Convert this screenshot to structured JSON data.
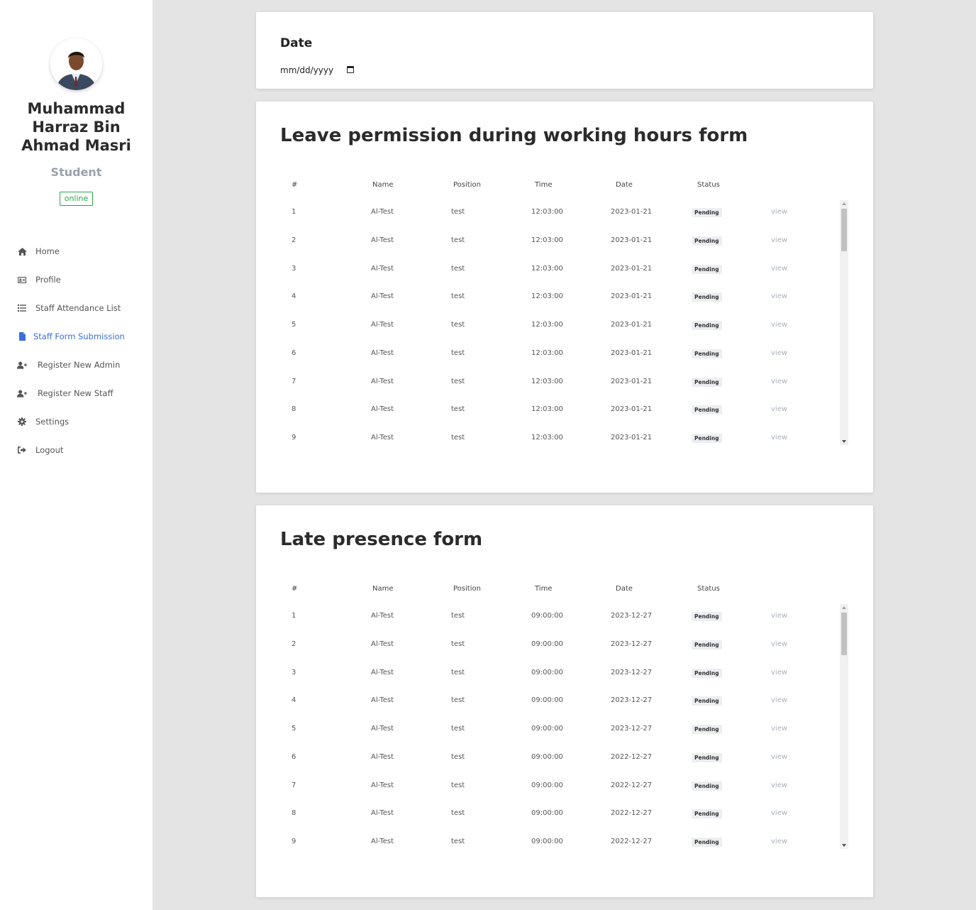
{
  "sidebar": {
    "user_name": "Muhammad Harraz Bin Ahmad Masri",
    "role": "Student",
    "status": "online",
    "nav": [
      {
        "label": "Home",
        "icon": "home-icon"
      },
      {
        "label": "Profile",
        "icon": "id-card-icon"
      },
      {
        "label": "Staff Attendance List",
        "icon": "list-icon"
      },
      {
        "label": "Staff Form Submission",
        "icon": "file-icon",
        "active": true
      },
      {
        "label": "Register New Admin",
        "icon": "user-plus-icon"
      },
      {
        "label": "Register New Staff",
        "icon": "user-plus-icon"
      },
      {
        "label": "Settings",
        "icon": "gear-icon"
      },
      {
        "label": "Logout",
        "icon": "sign-out-icon"
      }
    ]
  },
  "date_filter": {
    "label": "Date",
    "placeholder": "mm/dd/yyyy"
  },
  "columns": [
    "#",
    "Name",
    "Position",
    "Time",
    "Date",
    "Status"
  ],
  "leave_form": {
    "title": "Leave permission during working hours form",
    "rows": [
      {
        "num": "1",
        "name": "Al-Test",
        "position": "test",
        "time": "12:03:00",
        "date": "2023-01-21",
        "status": "Pending",
        "action": "view"
      },
      {
        "num": "2",
        "name": "Al-Test",
        "position": "test",
        "time": "12:03:00",
        "date": "2023-01-21",
        "status": "Pending",
        "action": "view"
      },
      {
        "num": "3",
        "name": "Al-Test",
        "position": "test",
        "time": "12:03:00",
        "date": "2023-01-21",
        "status": "Pending",
        "action": "view"
      },
      {
        "num": "4",
        "name": "Al-Test",
        "position": "test",
        "time": "12:03:00",
        "date": "2023-01-21",
        "status": "Pending",
        "action": "view"
      },
      {
        "num": "5",
        "name": "Al-Test",
        "position": "test",
        "time": "12:03:00",
        "date": "2023-01-21",
        "status": "Pending",
        "action": "view"
      },
      {
        "num": "6",
        "name": "Al-Test",
        "position": "test",
        "time": "12:03:00",
        "date": "2023-01-21",
        "status": "Pending",
        "action": "view"
      },
      {
        "num": "7",
        "name": "Al-Test",
        "position": "test",
        "time": "12:03:00",
        "date": "2023-01-21",
        "status": "Pending",
        "action": "view"
      },
      {
        "num": "8",
        "name": "Al-Test",
        "position": "test",
        "time": "12:03:00",
        "date": "2023-01-21",
        "status": "Pending",
        "action": "view"
      },
      {
        "num": "9",
        "name": "Al-Test",
        "position": "test",
        "time": "12:03:00",
        "date": "2023-01-21",
        "status": "Pending",
        "action": "view"
      }
    ]
  },
  "late_form": {
    "title": "Late presence form",
    "rows": [
      {
        "num": "1",
        "name": "Al-Test",
        "position": "test",
        "time": "09:00:00",
        "date": "2023-12-27",
        "status": "Pending",
        "action": "view"
      },
      {
        "num": "2",
        "name": "Al-Test",
        "position": "test",
        "time": "09:00:00",
        "date": "2023-12-27",
        "status": "Pending",
        "action": "view"
      },
      {
        "num": "3",
        "name": "Al-Test",
        "position": "test",
        "time": "09:00:00",
        "date": "2023-12-27",
        "status": "Pending",
        "action": "view"
      },
      {
        "num": "4",
        "name": "Al-Test",
        "position": "test",
        "time": "09:00:00",
        "date": "2023-12-27",
        "status": "Pending",
        "action": "view"
      },
      {
        "num": "5",
        "name": "Al-Test",
        "position": "test",
        "time": "09:00:00",
        "date": "2023-12-27",
        "status": "Pending",
        "action": "view"
      },
      {
        "num": "6",
        "name": "Al-Test",
        "position": "test",
        "time": "09:00:00",
        "date": "2022-12-27",
        "status": "Pending",
        "action": "view"
      },
      {
        "num": "7",
        "name": "Al-Test",
        "position": "test",
        "time": "09:00:00",
        "date": "2022-12-27",
        "status": "Pending",
        "action": "view"
      },
      {
        "num": "8",
        "name": "Al-Test",
        "position": "test",
        "time": "09:00:00",
        "date": "2022-12-27",
        "status": "Pending",
        "action": "view"
      },
      {
        "num": "9",
        "name": "Al-Test",
        "position": "test",
        "time": "09:00:00",
        "date": "2022-12-27",
        "status": "Pending",
        "action": "view"
      }
    ]
  },
  "colors": {
    "active_nav": "#3a6fd8",
    "online": "#28a745",
    "background": "#e4e4e4"
  }
}
